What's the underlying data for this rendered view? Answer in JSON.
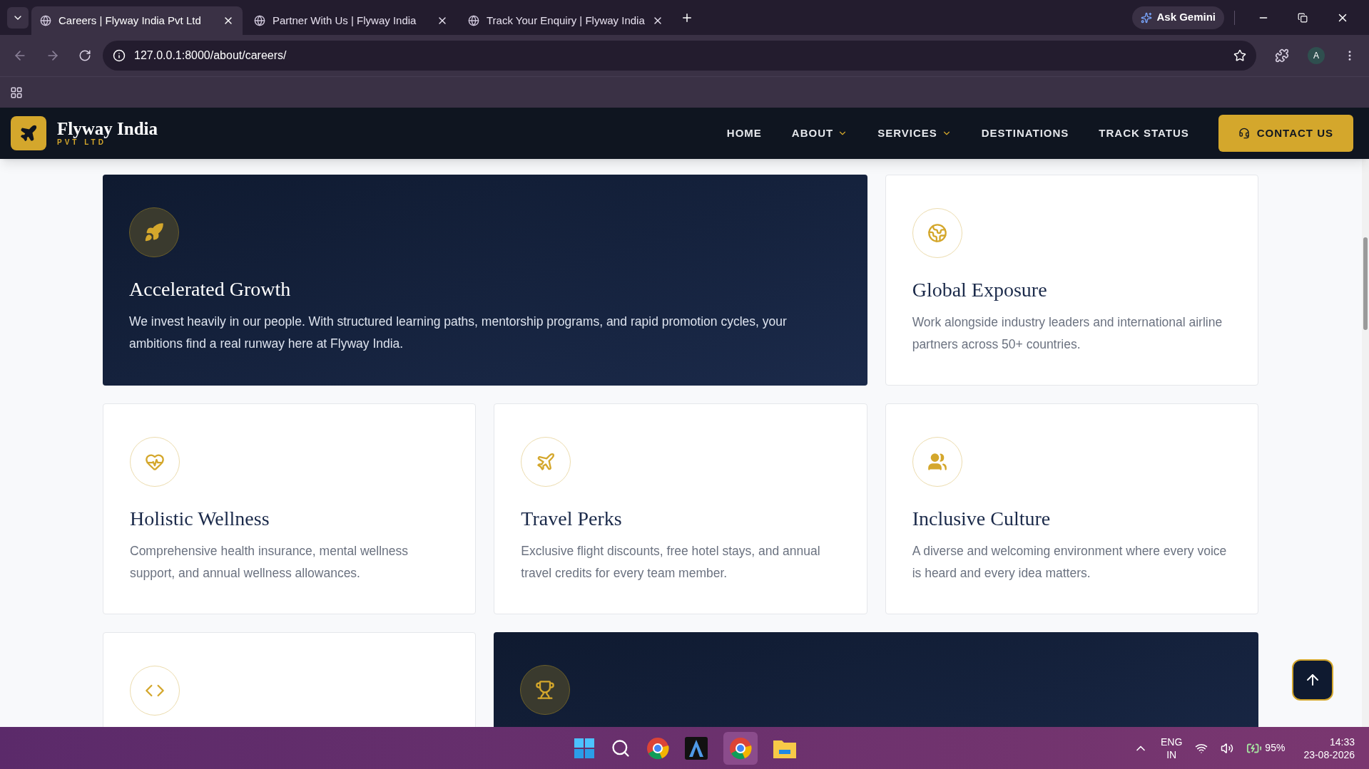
{
  "browser": {
    "tabs": [
      {
        "title": "Careers | Flyway India Pvt Ltd",
        "selected": true
      },
      {
        "title": "Partner With Us | Flyway India",
        "selected": false
      },
      {
        "title": "Track Your Enquiry | Flyway India",
        "selected": false
      }
    ],
    "ask_gemini": "Ask Gemini",
    "url": "127.0.0.1:8000/about/careers/",
    "profile": "A"
  },
  "site": {
    "brand": "Flyway India",
    "tagline": "PVT LTD",
    "nav": [
      {
        "label": "HOME",
        "dropdown": false
      },
      {
        "label": "ABOUT",
        "dropdown": true
      },
      {
        "label": "SERVICES",
        "dropdown": true
      },
      {
        "label": "DESTINATIONS",
        "dropdown": false
      },
      {
        "label": "TRACK STATUS",
        "dropdown": false
      }
    ],
    "contact": "CONTACT US"
  },
  "cards": [
    {
      "kind": "dark",
      "wide": true,
      "title": "Accelerated Growth",
      "text": "We invest heavily in our people. With structured learning paths, mentorship programs, and rapid promotion cycles, your ambitions find a real runway here at Flyway India."
    },
    {
      "kind": "light",
      "wide": false,
      "title": "Global Exposure",
      "text": "Work alongside industry leaders and international airline partners across 50+ countries."
    },
    {
      "kind": "light",
      "wide": false,
      "title": "Holistic Wellness",
      "text": "Comprehensive health insurance, mental wellness support, and annual wellness allowances."
    },
    {
      "kind": "light",
      "wide": false,
      "title": "Travel Perks",
      "text": "Exclusive flight discounts, free hotel stays, and annual travel credits for every team member."
    },
    {
      "kind": "light",
      "wide": false,
      "title": "Inclusive Culture",
      "text": "A diverse and welcoming environment where every voice is heard and every idea matters."
    },
    {
      "kind": "light",
      "wide": false
    },
    {
      "kind": "dark",
      "wide": true
    }
  ],
  "taskbar": {
    "language": "ENG",
    "region": "IN",
    "battery": "95%",
    "time": "14:33",
    "date": "23-08-2026"
  }
}
